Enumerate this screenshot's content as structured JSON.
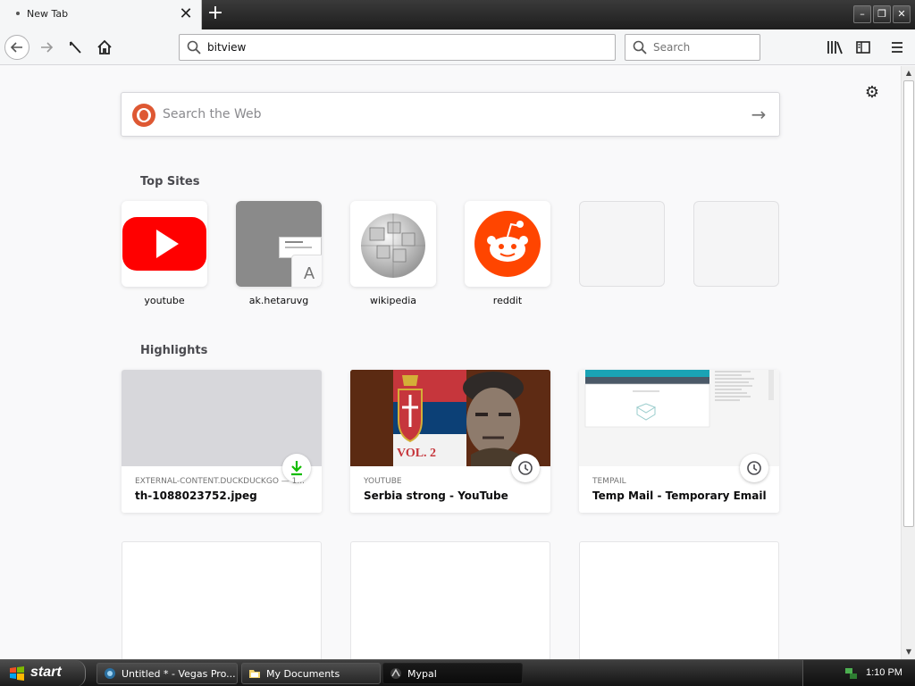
{
  "tab": {
    "title": "New Tab"
  },
  "navbar": {
    "url": "bitview",
    "search_placeholder": "Search"
  },
  "newtab": {
    "websearch_placeholder": "Search the Web",
    "topsites_title": "Top Sites",
    "highlights_title": "Highlights",
    "topsites": [
      {
        "label": "youtube"
      },
      {
        "label": "ak.hetaruvg",
        "fallback_letter": "A"
      },
      {
        "label": "wikipedia"
      },
      {
        "label": "reddit"
      },
      {
        "label": ""
      },
      {
        "label": ""
      }
    ],
    "highlights": [
      {
        "source": "EXTERNAL-CONTENT.DUCKDUCKGO — 1...",
        "title": "th-1088023752.jpeg",
        "badge": "download-icon"
      },
      {
        "source": "YOUTUBE",
        "title": "Serbia strong - YouTube",
        "badge": "history-icon"
      },
      {
        "source": "TEMPAIL",
        "title": "Temp Mail - Temporary Email",
        "badge": "history-icon"
      }
    ],
    "serbia_thumb_text": "VOL. 2"
  },
  "taskbar": {
    "start_label": "start",
    "tasks": [
      {
        "label": "Untitled * - Vegas Pro..."
      },
      {
        "label": "My Documents"
      },
      {
        "label": "Mypal"
      }
    ],
    "clock": "1:10 PM"
  },
  "colors": {
    "youtube_red": "#ff0000",
    "reddit_orange": "#ff4500",
    "duckduckgo": "#de5833",
    "download_green": "#12bc00"
  }
}
